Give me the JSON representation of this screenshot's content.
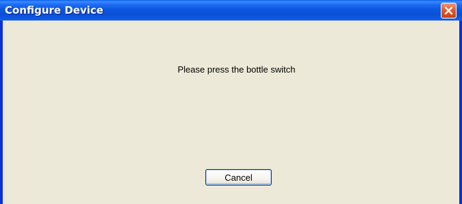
{
  "window": {
    "title": "Configure Device"
  },
  "dialog": {
    "message": "Please press the bottle switch",
    "cancel_label": "Cancel"
  },
  "icons": {
    "close": "close-icon"
  },
  "colors": {
    "titlebar": "#0a4fd6",
    "client_background": "#ece9d8",
    "close_button": "#e15b2e"
  }
}
